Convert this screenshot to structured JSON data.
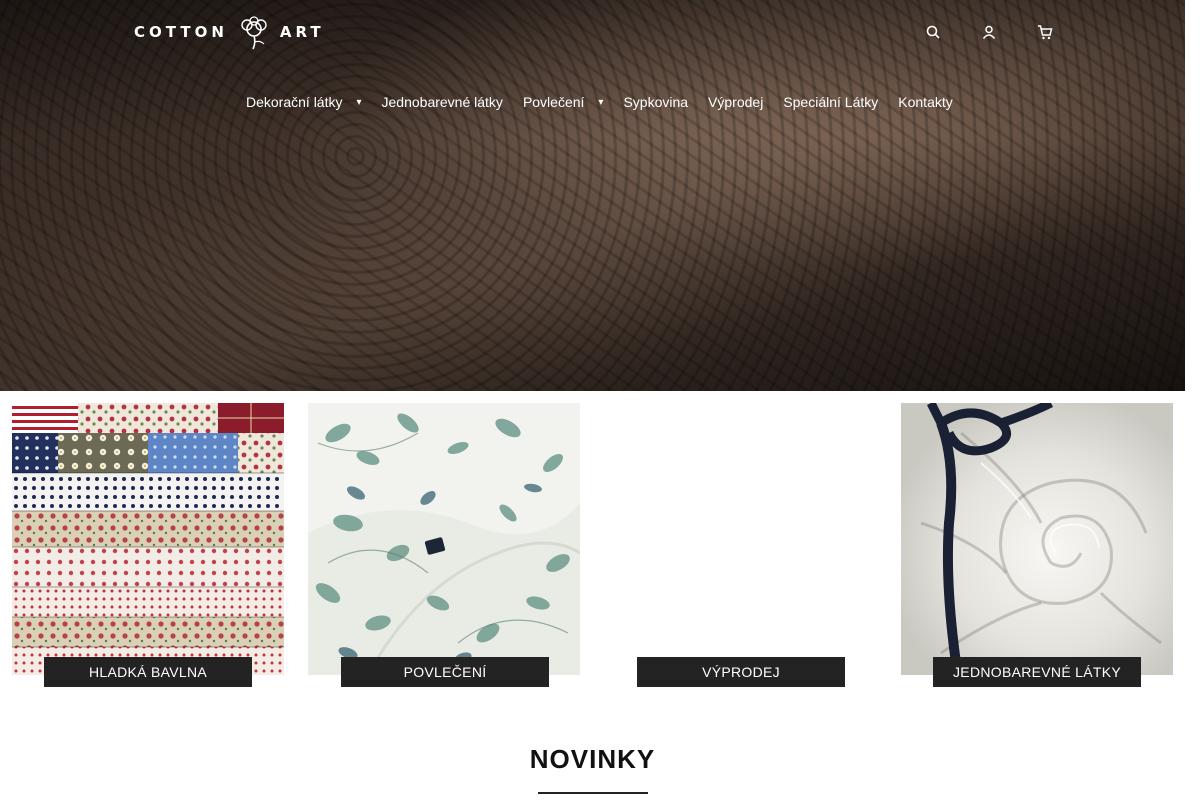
{
  "brand": {
    "logo_left": "COTTON",
    "logo_right": "ART"
  },
  "header_icons": [
    "search-icon",
    "user-icon",
    "cart-icon"
  ],
  "nav": {
    "items": [
      {
        "label": "Dekorační látky",
        "has_dropdown": true
      },
      {
        "label": "Jednobarevné látky",
        "has_dropdown": false
      },
      {
        "label": "Povlečení",
        "has_dropdown": true
      },
      {
        "label": "Sypkovina",
        "has_dropdown": false
      },
      {
        "label": "Výprodej",
        "has_dropdown": false
      },
      {
        "label": "Speciální Látky",
        "has_dropdown": false
      },
      {
        "label": "Kontakty",
        "has_dropdown": false
      }
    ]
  },
  "categories": [
    {
      "label": "HLADKÁ BAVLNA"
    },
    {
      "label": "POVLEČENÍ"
    },
    {
      "label": "VÝPRODEJ"
    },
    {
      "label": "JEDNOBAREVNÉ LÁTKY"
    }
  ],
  "section": {
    "title": "NOVINKY"
  },
  "colors": {
    "label_bg": "#232323",
    "hero_tone": "#4a3a31",
    "text_dark": "#111111"
  }
}
